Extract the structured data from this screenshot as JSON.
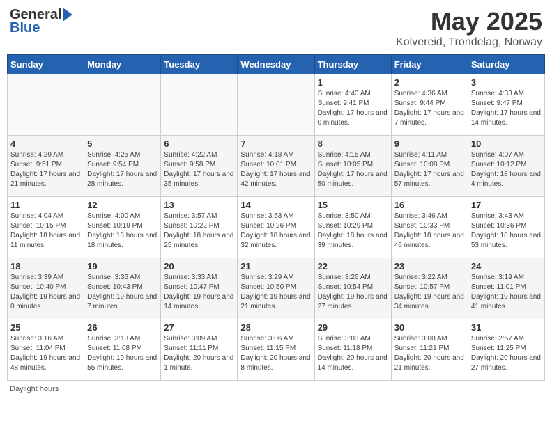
{
  "header": {
    "logo_general": "General",
    "logo_blue": "Blue",
    "main_title": "May 2025",
    "subtitle": "Kolvereid, Trondelag, Norway"
  },
  "footer": {
    "daylight_label": "Daylight hours"
  },
  "days_of_week": [
    "Sunday",
    "Monday",
    "Tuesday",
    "Wednesday",
    "Thursday",
    "Friday",
    "Saturday"
  ],
  "weeks": [
    [
      {
        "day": "",
        "sunrise": "",
        "sunset": "",
        "daylight": ""
      },
      {
        "day": "",
        "sunrise": "",
        "sunset": "",
        "daylight": ""
      },
      {
        "day": "",
        "sunrise": "",
        "sunset": "",
        "daylight": ""
      },
      {
        "day": "",
        "sunrise": "",
        "sunset": "",
        "daylight": ""
      },
      {
        "day": "1",
        "sunrise": "Sunrise: 4:40 AM",
        "sunset": "Sunset: 9:41 PM",
        "daylight": "Daylight: 17 hours and 0 minutes."
      },
      {
        "day": "2",
        "sunrise": "Sunrise: 4:36 AM",
        "sunset": "Sunset: 9:44 PM",
        "daylight": "Daylight: 17 hours and 7 minutes."
      },
      {
        "day": "3",
        "sunrise": "Sunrise: 4:33 AM",
        "sunset": "Sunset: 9:47 PM",
        "daylight": "Daylight: 17 hours and 14 minutes."
      }
    ],
    [
      {
        "day": "4",
        "sunrise": "Sunrise: 4:29 AM",
        "sunset": "Sunset: 9:51 PM",
        "daylight": "Daylight: 17 hours and 21 minutes."
      },
      {
        "day": "5",
        "sunrise": "Sunrise: 4:25 AM",
        "sunset": "Sunset: 9:54 PM",
        "daylight": "Daylight: 17 hours and 28 minutes."
      },
      {
        "day": "6",
        "sunrise": "Sunrise: 4:22 AM",
        "sunset": "Sunset: 9:58 PM",
        "daylight": "Daylight: 17 hours and 35 minutes."
      },
      {
        "day": "7",
        "sunrise": "Sunrise: 4:18 AM",
        "sunset": "Sunset: 10:01 PM",
        "daylight": "Daylight: 17 hours and 42 minutes."
      },
      {
        "day": "8",
        "sunrise": "Sunrise: 4:15 AM",
        "sunset": "Sunset: 10:05 PM",
        "daylight": "Daylight: 17 hours and 50 minutes."
      },
      {
        "day": "9",
        "sunrise": "Sunrise: 4:11 AM",
        "sunset": "Sunset: 10:08 PM",
        "daylight": "Daylight: 17 hours and 57 minutes."
      },
      {
        "day": "10",
        "sunrise": "Sunrise: 4:07 AM",
        "sunset": "Sunset: 10:12 PM",
        "daylight": "Daylight: 18 hours and 4 minutes."
      }
    ],
    [
      {
        "day": "11",
        "sunrise": "Sunrise: 4:04 AM",
        "sunset": "Sunset: 10:15 PM",
        "daylight": "Daylight: 18 hours and 11 minutes."
      },
      {
        "day": "12",
        "sunrise": "Sunrise: 4:00 AM",
        "sunset": "Sunset: 10:19 PM",
        "daylight": "Daylight: 18 hours and 18 minutes."
      },
      {
        "day": "13",
        "sunrise": "Sunrise: 3:57 AM",
        "sunset": "Sunset: 10:22 PM",
        "daylight": "Daylight: 18 hours and 25 minutes."
      },
      {
        "day": "14",
        "sunrise": "Sunrise: 3:53 AM",
        "sunset": "Sunset: 10:26 PM",
        "daylight": "Daylight: 18 hours and 32 minutes."
      },
      {
        "day": "15",
        "sunrise": "Sunrise: 3:50 AM",
        "sunset": "Sunset: 10:29 PM",
        "daylight": "Daylight: 18 hours and 39 minutes."
      },
      {
        "day": "16",
        "sunrise": "Sunrise: 3:46 AM",
        "sunset": "Sunset: 10:33 PM",
        "daylight": "Daylight: 18 hours and 46 minutes."
      },
      {
        "day": "17",
        "sunrise": "Sunrise: 3:43 AM",
        "sunset": "Sunset: 10:36 PM",
        "daylight": "Daylight: 18 hours and 53 minutes."
      }
    ],
    [
      {
        "day": "18",
        "sunrise": "Sunrise: 3:39 AM",
        "sunset": "Sunset: 10:40 PM",
        "daylight": "Daylight: 19 hours and 0 minutes."
      },
      {
        "day": "19",
        "sunrise": "Sunrise: 3:36 AM",
        "sunset": "Sunset: 10:43 PM",
        "daylight": "Daylight: 19 hours and 7 minutes."
      },
      {
        "day": "20",
        "sunrise": "Sunrise: 3:33 AM",
        "sunset": "Sunset: 10:47 PM",
        "daylight": "Daylight: 19 hours and 14 minutes."
      },
      {
        "day": "21",
        "sunrise": "Sunrise: 3:29 AM",
        "sunset": "Sunset: 10:50 PM",
        "daylight": "Daylight: 19 hours and 21 minutes."
      },
      {
        "day": "22",
        "sunrise": "Sunrise: 3:26 AM",
        "sunset": "Sunset: 10:54 PM",
        "daylight": "Daylight: 19 hours and 27 minutes."
      },
      {
        "day": "23",
        "sunrise": "Sunrise: 3:22 AM",
        "sunset": "Sunset: 10:57 PM",
        "daylight": "Daylight: 19 hours and 34 minutes."
      },
      {
        "day": "24",
        "sunrise": "Sunrise: 3:19 AM",
        "sunset": "Sunset: 11:01 PM",
        "daylight": "Daylight: 19 hours and 41 minutes."
      }
    ],
    [
      {
        "day": "25",
        "sunrise": "Sunrise: 3:16 AM",
        "sunset": "Sunset: 11:04 PM",
        "daylight": "Daylight: 19 hours and 48 minutes."
      },
      {
        "day": "26",
        "sunrise": "Sunrise: 3:13 AM",
        "sunset": "Sunset: 11:08 PM",
        "daylight": "Daylight: 19 hours and 55 minutes."
      },
      {
        "day": "27",
        "sunrise": "Sunrise: 3:09 AM",
        "sunset": "Sunset: 11:11 PM",
        "daylight": "Daylight: 20 hours and 1 minute."
      },
      {
        "day": "28",
        "sunrise": "Sunrise: 3:06 AM",
        "sunset": "Sunset: 11:15 PM",
        "daylight": "Daylight: 20 hours and 8 minutes."
      },
      {
        "day": "29",
        "sunrise": "Sunrise: 3:03 AM",
        "sunset": "Sunset: 11:18 PM",
        "daylight": "Daylight: 20 hours and 14 minutes."
      },
      {
        "day": "30",
        "sunrise": "Sunrise: 3:00 AM",
        "sunset": "Sunset: 11:21 PM",
        "daylight": "Daylight: 20 hours and 21 minutes."
      },
      {
        "day": "31",
        "sunrise": "Sunrise: 2:57 AM",
        "sunset": "Sunset: 11:25 PM",
        "daylight": "Daylight: 20 hours and 27 minutes."
      }
    ]
  ]
}
